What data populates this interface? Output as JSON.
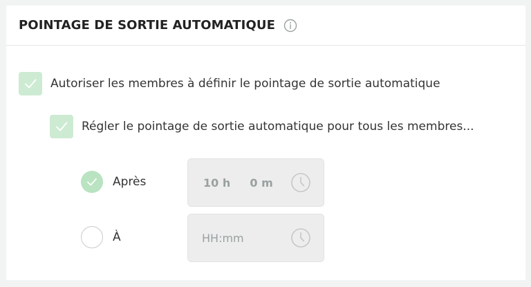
{
  "section": {
    "title": "POINTAGE DE SORTIE AUTOMATIQUE",
    "info_icon": "info-circle-icon"
  },
  "options": {
    "allow_members": {
      "label": "Autoriser les membres à définir le pointage de sortie automatique",
      "checked": true
    },
    "set_for_all": {
      "label": "Régler le pointage de sortie automatique pour tous les membres...",
      "checked": true
    }
  },
  "mode": {
    "after": {
      "label": "Après",
      "selected": true,
      "hours_value": "10 h",
      "minutes_value": "0 m",
      "icon": "clock-icon"
    },
    "at": {
      "label": "À",
      "selected": false,
      "placeholder": "HH:mm",
      "icon": "clock-icon"
    }
  },
  "colors": {
    "checkbox_fill": "#cdebd2",
    "check_stroke": "#ffffff",
    "radio_selected": "#b9e3c1",
    "field_bg": "#ededed",
    "field_text": "#9aa0a0"
  }
}
